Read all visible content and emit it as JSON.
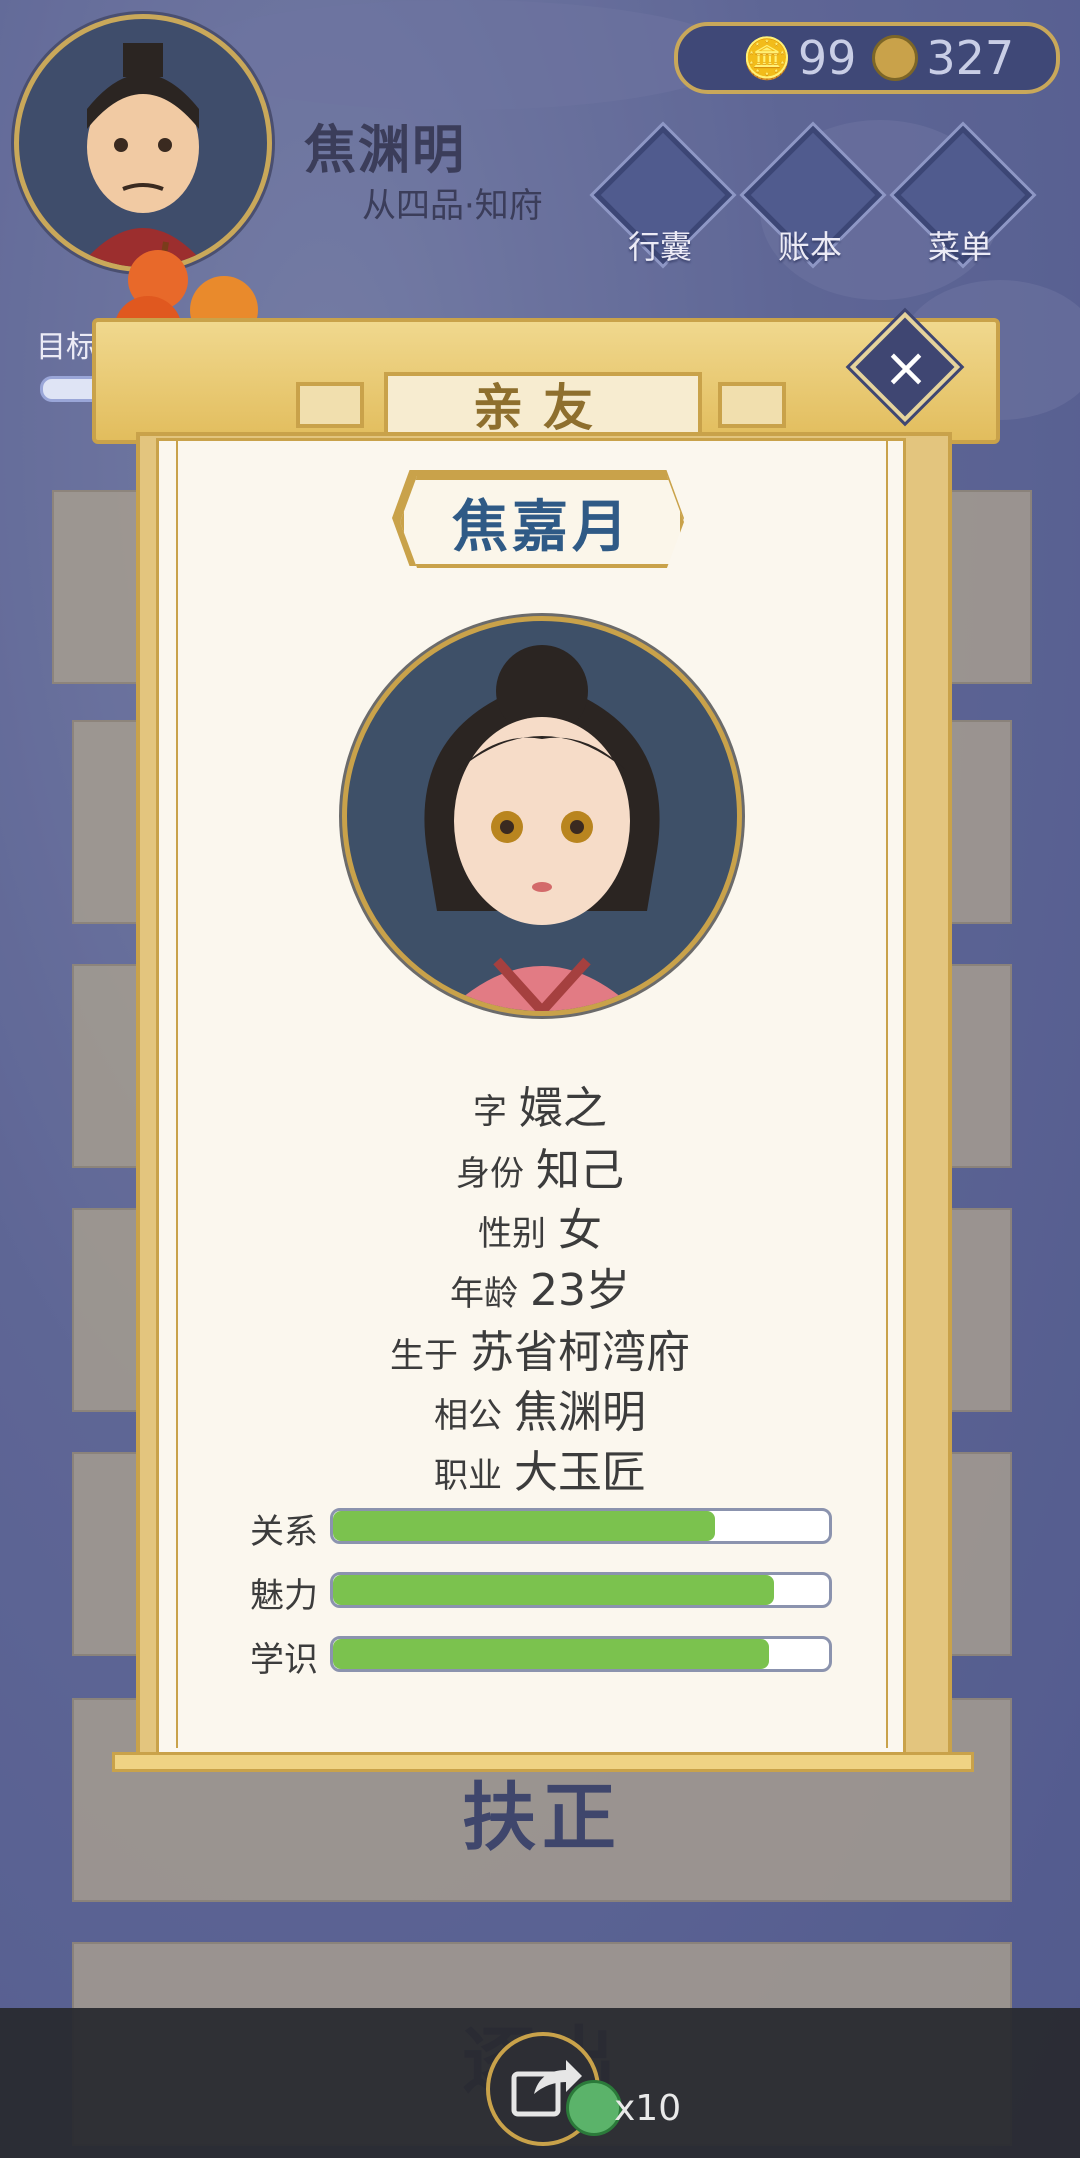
{
  "header": {
    "player_name": "焦渊明",
    "player_rank": "从四品·知府",
    "silver": "99",
    "coins": "327",
    "goal_label": "目标"
  },
  "menu": [
    {
      "label": "行囊",
      "icon": "pouch-icon"
    },
    {
      "label": "账本",
      "icon": "ledger-icon"
    },
    {
      "label": "菜单",
      "icon": "menu-dots-icon"
    }
  ],
  "background_cards": {
    "card5_label": "扶正",
    "card6_label": "逐出"
  },
  "modal": {
    "title": "亲友",
    "name": "焦嘉月",
    "fields": [
      {
        "key": "字",
        "value": "嬛之"
      },
      {
        "key": "身份",
        "value": "知己"
      },
      {
        "key": "性别",
        "value": "女"
      },
      {
        "key": "年龄",
        "value": "23岁"
      },
      {
        "key": "生于",
        "value": "苏省柯湾府"
      },
      {
        "key": "相公",
        "value": "焦渊明"
      },
      {
        "key": "职业",
        "value": "大玉匠"
      }
    ],
    "stats": [
      {
        "label": "关系",
        "fraction": 0.77
      },
      {
        "label": "魅力",
        "fraction": 0.89
      },
      {
        "label": "学识",
        "fraction": 0.88
      }
    ]
  },
  "share": {
    "count": "x10"
  },
  "colors": {
    "accent_gold": "#c9a24a",
    "stat_green": "#7bc24e",
    "name_blue": "#2f5a86"
  }
}
